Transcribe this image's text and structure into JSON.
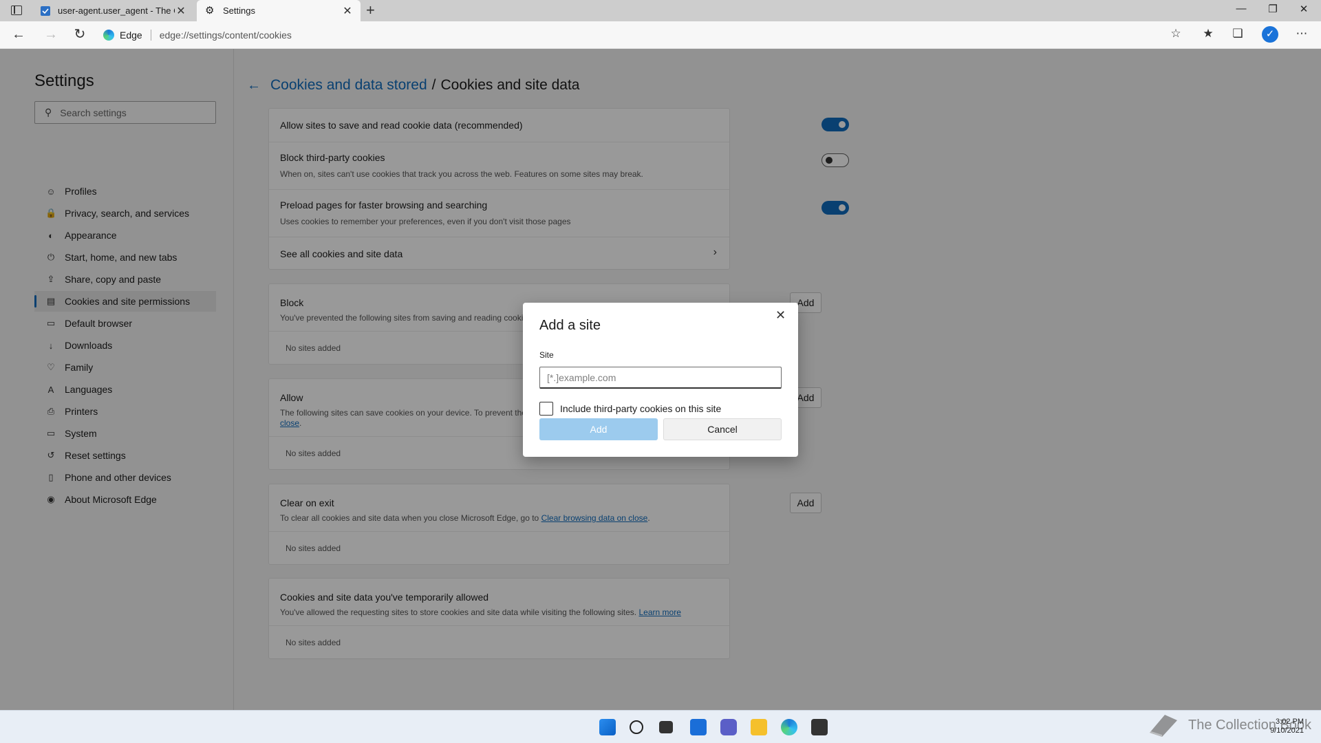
{
  "browser": {
    "tabs": [
      {
        "title": "user-agent.user_agent - The Co"
      },
      {
        "title": "Settings"
      }
    ],
    "address": {
      "brand": "Edge",
      "url": "edge://settings/content/cookies"
    }
  },
  "sidebar": {
    "title": "Settings",
    "search_placeholder": "Search settings",
    "items": [
      {
        "label": "Profiles",
        "icon": "profile-icon"
      },
      {
        "label": "Privacy, search, and services",
        "icon": "lock-icon"
      },
      {
        "label": "Appearance",
        "icon": "appearance-icon"
      },
      {
        "label": "Start, home, and new tabs",
        "icon": "power-icon"
      },
      {
        "label": "Share, copy and paste",
        "icon": "share-icon"
      },
      {
        "label": "Cookies and site permissions",
        "icon": "cookies-icon",
        "active": true
      },
      {
        "label": "Default browser",
        "icon": "browser-icon"
      },
      {
        "label": "Downloads",
        "icon": "download-icon"
      },
      {
        "label": "Family",
        "icon": "family-icon"
      },
      {
        "label": "Languages",
        "icon": "language-icon"
      },
      {
        "label": "Printers",
        "icon": "printer-icon"
      },
      {
        "label": "System",
        "icon": "system-icon"
      },
      {
        "label": "Reset settings",
        "icon": "reset-icon"
      },
      {
        "label": "Phone and other devices",
        "icon": "phone-icon"
      },
      {
        "label": "About Microsoft Edge",
        "icon": "edge-icon"
      }
    ]
  },
  "main": {
    "breadcrumb_parent": "Cookies and data stored",
    "breadcrumb_sep": "/",
    "breadcrumb_current": "Cookies and site data",
    "settings": {
      "allow_title": "Allow sites to save and read cookie data (recommended)",
      "allow_on": true,
      "block3p_title": "Block third-party cookies",
      "block3p_desc": "When on, sites can't use cookies that track you across the web. Features on some sites may break.",
      "block3p_on": false,
      "preload_title": "Preload pages for faster browsing and searching",
      "preload_desc": "Uses cookies to remember your preferences, even if you don't visit those pages",
      "preload_on": true,
      "see_all": "See all cookies and site data"
    },
    "block": {
      "title": "Block",
      "desc": "You've prevented the following sites from saving and reading cooki",
      "add": "Add",
      "empty": "No sites added"
    },
    "allow": {
      "title": "Allow",
      "desc": "The following sites can save cookies on your device. To prevent the",
      "desc_link": "close",
      "add": "Add",
      "empty": "No sites added"
    },
    "clear": {
      "title": "Clear on exit",
      "desc": "To clear all cookies and site data when you close Microsoft Edge, go to",
      "desc_link": "Clear browsing data on close",
      "add": "Add",
      "empty": "No sites added"
    },
    "temp": {
      "title": "Cookies and site data you've temporarily allowed",
      "desc": "You've allowed the requesting sites to store cookies and site data while visiting the following sites.",
      "desc_link": "Learn more",
      "empty": "No sites added"
    }
  },
  "dialog": {
    "title": "Add a site",
    "site_label": "Site",
    "site_placeholder": "[*.]example.com",
    "site_value": "",
    "checkbox_label": "Include third-party cookies on this site",
    "checkbox_checked": false,
    "add_label": "Add",
    "cancel_label": "Cancel"
  },
  "taskbar": {
    "time": "3:02 PM",
    "date": "9/10/2021",
    "watermark": "The Collection Book"
  },
  "colors": {
    "accent": "#0f6cbd",
    "disabled_button": "#9ccbee"
  }
}
